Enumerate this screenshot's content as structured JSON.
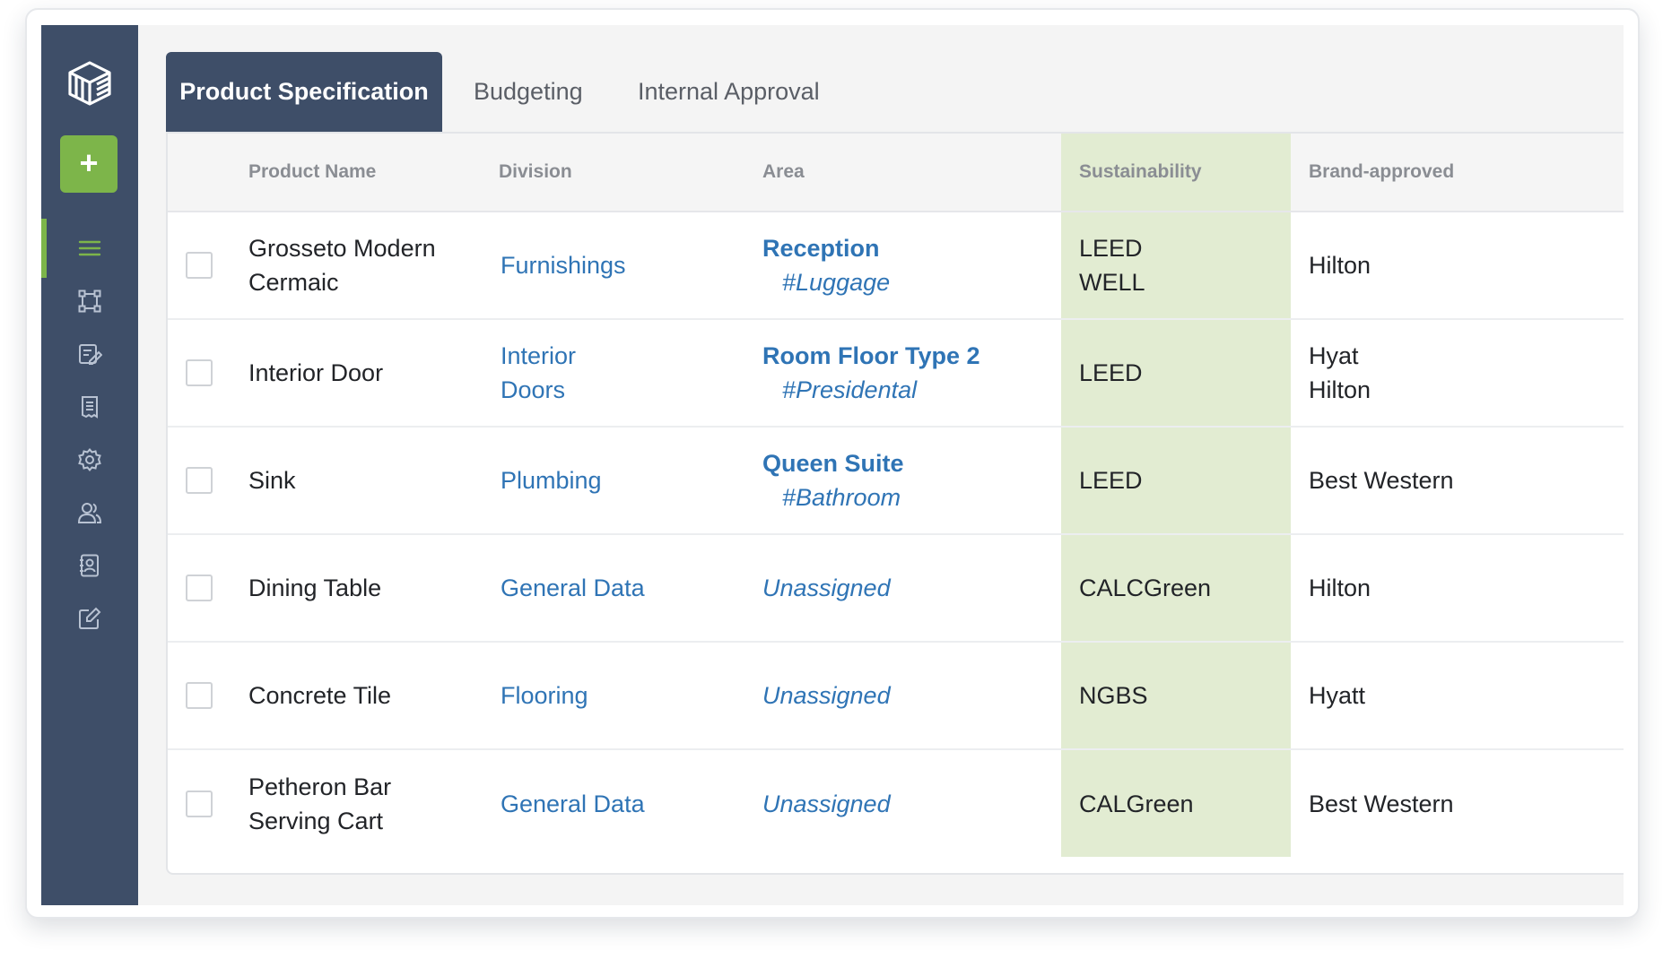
{
  "tabs": [
    {
      "label": "Product Specification",
      "active": true
    },
    {
      "label": "Budgeting",
      "active": false
    },
    {
      "label": "Internal Approval",
      "active": false
    }
  ],
  "sidebar": {
    "add_label": "+",
    "items": [
      {
        "icon": "list-icon",
        "active": true
      },
      {
        "icon": "vector-shape-icon",
        "active": false
      },
      {
        "icon": "edit-document-icon",
        "active": false
      },
      {
        "icon": "receipt-icon",
        "active": false
      },
      {
        "icon": "gear-icon",
        "active": false
      },
      {
        "icon": "users-icon",
        "active": false
      },
      {
        "icon": "contact-book-icon",
        "active": false
      },
      {
        "icon": "pencil-square-icon",
        "active": false
      }
    ]
  },
  "table": {
    "columns": [
      "Product Name",
      "Division",
      "Area",
      "Sustainability",
      "Brand-approved"
    ],
    "rows": [
      {
        "name": [
          "Grosseto Modern",
          "Cermaic"
        ],
        "division": [
          "Furnishings"
        ],
        "area_room": "Reception",
        "area_tag": "#Luggage",
        "sustainability": [
          "LEED",
          "WELL"
        ],
        "brand": [
          "Hilton"
        ]
      },
      {
        "name": [
          "Interior Door"
        ],
        "division": [
          "Interior",
          "Doors"
        ],
        "area_room": "Room Floor Type 2",
        "area_tag": "#Presidental",
        "sustainability": [
          "LEED"
        ],
        "brand": [
          "Hyat",
          "Hilton"
        ]
      },
      {
        "name": [
          "Sink"
        ],
        "division": [
          "Plumbing"
        ],
        "area_room": "Queen Suite",
        "area_tag": "#Bathroom",
        "sustainability": [
          "LEED"
        ],
        "brand": [
          "Best Western"
        ]
      },
      {
        "name": [
          "Dining Table"
        ],
        "division": [
          "General Data"
        ],
        "area_unassigned": "Unassigned",
        "sustainability": [
          "CALCGreen"
        ],
        "brand": [
          "Hilton"
        ]
      },
      {
        "name": [
          "Concrete Tile"
        ],
        "division": [
          "Flooring"
        ],
        "area_unassigned": "Unassigned",
        "sustainability": [
          "NGBS"
        ],
        "brand": [
          "Hyatt"
        ]
      },
      {
        "name": [
          "Petheron Bar",
          "Serving Cart"
        ],
        "division": [
          "General Data"
        ],
        "area_unassigned": "Unassigned",
        "sustainability": [
          "CALGreen"
        ],
        "brand": [
          "Best Western"
        ]
      }
    ]
  },
  "colors": {
    "sidebar": "#3e4e68",
    "accent_green": "#7db54a",
    "link_blue": "#2f74b5",
    "sustainability_bg": "#e2ecd2"
  }
}
